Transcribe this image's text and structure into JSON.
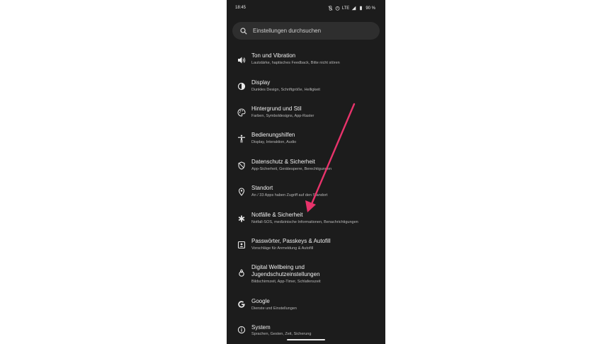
{
  "status": {
    "time": "18:45",
    "network": "LTE",
    "battery": "90 %"
  },
  "search": {
    "placeholder": "Einstellungen durchsuchen",
    "icon": "search-icon"
  },
  "items": [
    {
      "icon": "volume-icon",
      "title": "Ton und Vibration",
      "subtitle": "Lautstärke, haptisches Feedback, Bitte nicht stören"
    },
    {
      "icon": "display-icon",
      "title": "Display",
      "subtitle": "Dunkles Design, Schriftgröße, Helligkeit"
    },
    {
      "icon": "palette-icon",
      "title": "Hintergrund und Stil",
      "subtitle": "Farben, Symboldesigns, App-Raster"
    },
    {
      "icon": "accessibility-icon",
      "title": "Bedienungshilfen",
      "subtitle": "Display, Interaktion, Audio"
    },
    {
      "icon": "shield-icon",
      "title": "Datenschutz & Sicherheit",
      "subtitle": "App-Sicherheit, Gerätesperre, Berechtigungen"
    },
    {
      "icon": "location-icon",
      "title": "Standort",
      "subtitle": "An / 33 Apps haben Zugriff auf den Standort"
    },
    {
      "icon": "asterisk-icon",
      "title": "Notfälle & Sicherheit",
      "subtitle": "Notfall-SOS, medizinische Informationen, Benachrichtigungen"
    },
    {
      "icon": "password-icon",
      "title": "Passwörter, Passkeys & Autofill",
      "subtitle": "Vorschläge für Anmeldung & Autofill"
    },
    {
      "icon": "wellbeing-icon",
      "title": "Digital Wellbeing und",
      "title2": "Jugendschutzeinstellungen",
      "subtitle": "Bildschirmzeit, App-Timer, Schlafenszeit"
    },
    {
      "icon": "google-icon",
      "title": "Google",
      "subtitle": "Dienste und Einstellungen"
    },
    {
      "icon": "info-icon",
      "title": "System",
      "subtitle": "Sprachen, Gesten, Zeit, Sicherung"
    }
  ],
  "colors": {
    "background": "#1c1c1c",
    "search_bg": "#2e2e2e",
    "arrow": "#e8336b"
  }
}
